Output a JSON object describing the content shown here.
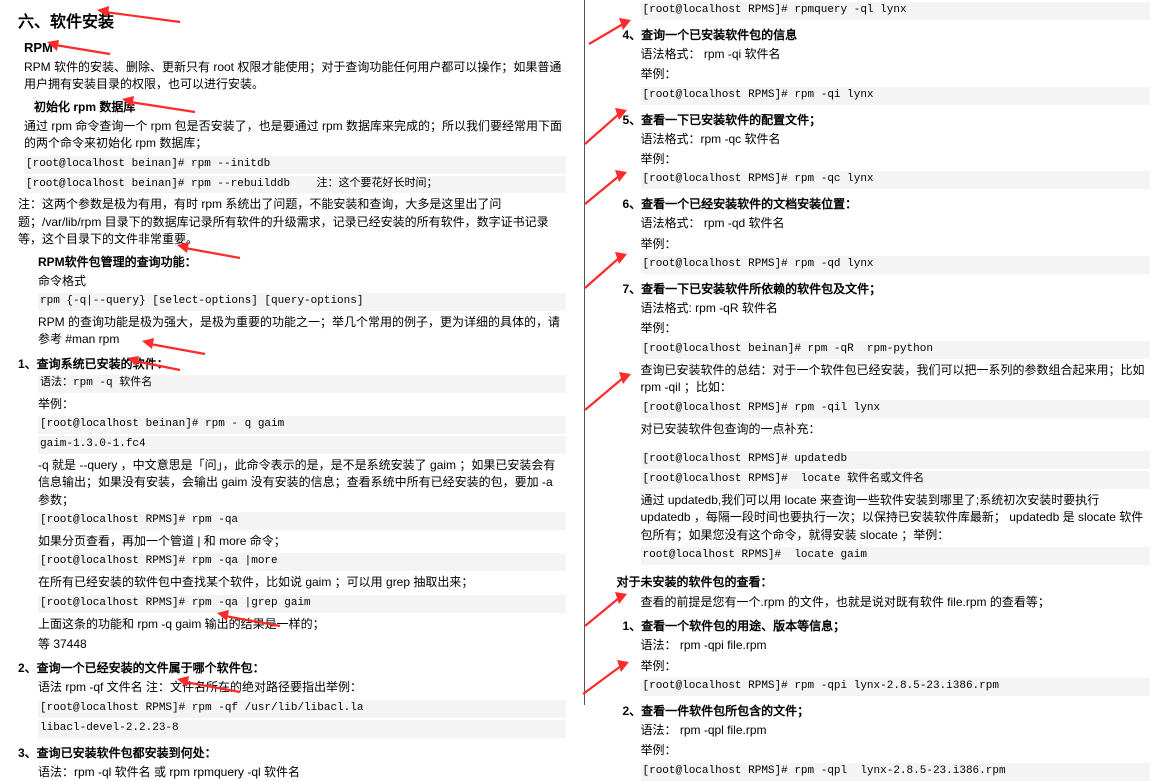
{
  "left": {
    "title": "六、软件安装",
    "rpm_hdr": "RPM",
    "para1": "RPM 软件的安装、删除、更新只有 root 权限才能使用；对于查询功能任何用户都可以操作；如果普通用户拥有安装目录的权限，也可以进行安装。",
    "init_hdr": "初始化 rpm 数据库",
    "init_p": "通过 rpm 命令查询一个 rpm 包是否安装了，也是要通过 rpm 数据库来完成的；所以我们要经常用下面的两个命令来初始化 rpm 数据库；",
    "init_c1": "[root@localhost beinan]# rpm --initdb",
    "init_c2": "[root@localhost beinan]# rpm --rebuilddb    注：这个要花好长时间；",
    "init_note": "注：这两个参数是极为有用，有时 rpm 系统出了问题，不能安装和查询，大多是这里出了问题；/var/lib/rpm 目录下的数据库记录所有软件的升级需求，记录已经安装的所有软件，数字证书记录等，这个目录下的文件非常重要。",
    "query_hdr": "RPM软件包管理的查询功能：",
    "query_fmt_lbl": "命令格式",
    "query_fmt": "rpm {-q|--query} [select-options] [query-options]",
    "query_note": "RPM 的查询功能是极为强大，是极为重要的功能之一；举几个常用的例子，更为详细的具体的，请参考 #man rpm",
    "i1_hdr": "1、查询系统已安装的软件：",
    "i1_syn": "语法：rpm -q 软件名",
    "i1_eg": "举例：",
    "i1_c1": "[root@localhost beinan]# rpm - q gaim",
    "i1_c2": "gaim-1.3.0-1.fc4",
    "i1_note": "-q 就是 --query ，中文意思是「问」，此命令表示的是，是不是系统安装了 gaim ；如果已安装会有信息输出；如果没有安装，会输出 gaim 没有安装的信息；查看系统中所有已经安装的包，要加 -a 参数；",
    "i1_c3": "[root@localhost RPMS]# rpm -qa",
    "i1_note2": "如果分页查看，再加一个管道 | 和 more 命令；",
    "i1_c4": "[root@localhost RPMS]# rpm -qa |more",
    "i1_note3": "在所有已经安装的软件包中查找某个软件，比如说 gaim ；可以用 grep 抽取出来；",
    "i1_c5": "[root@localhost RPMS]# rpm -qa |grep gaim",
    "i1_note4": "上面这条的功能和 rpm -q gaim 输出的结果是一样的；",
    "i1_note5": "等 37448",
    "i2_hdr": "2、查询一个已经安装的文件属于哪个软件包：",
    "i2_syn": "语法 rpm -qf 文件名   注：文件名所在的绝对路径要指出举例：",
    "i2_c1": "[root@localhost RPMS]# rpm -qf /usr/lib/libacl.la",
    "i2_c2": "libacl-devel-2.2.23-8",
    "i3_hdr": "3、查询已安装软件包都安装到何处：",
    "i3_syn": "语法：rpm -ql   软件名   或 rpm rpmquery -ql   软件名"
  },
  "right": {
    "pre_c": "[root@localhost RPMS]# rpmquery -ql lynx",
    "i4_hdr": "4、查询一个已安装软件包的信息",
    "i4_syn": "语法格式： rpm -qi 软件名",
    "i4_eg": "举例：",
    "i4_c1": "[root@localhost RPMS]# rpm -qi lynx",
    "i5_hdr": "5、查看一下已安装软件的配置文件；",
    "i5_syn": "语法格式：rpm -qc 软件名",
    "i5_eg": "举例：",
    "i5_c1": "[root@localhost RPMS]# rpm -qc lynx",
    "i6_hdr": "6、查看一个已经安装软件的文档安装位置：",
    "i6_syn": "语法格式： rpm -qd 软件名",
    "i6_eg": "举例：",
    "i6_c1": "[root@localhost RPMS]# rpm -qd lynx",
    "i7_hdr": "7、查看一下已安装软件所依赖的软件包及文件；",
    "i7_syn": "语法格式: rpm -qR 软件名",
    "i7_eg": "举例：",
    "i7_c1": "[root@localhost beinan]# rpm -qR  rpm-python",
    "i7_note": "查询已安装软件的总结：对于一个软件包已经安装，我们可以把一系列的参数组合起来用；比如 rpm -qil ；比如：",
    "i7_c2": "[root@localhost RPMS]# rpm -qil lynx",
    "i7_note2": "对已安装软件包查询的一点补充：",
    "i7_c3": "[root@localhost RPMS]# updatedb",
    "i7_c4": "[root@localhost RPMS]#  locate 软件名或文件名",
    "i7_note3": "通过 updatedb,我们可以用 locate 来查询一些软件安装到哪里了;系统初次安装时要执行 updatedb ，每隔一段时间也要执行一次；以保持已安装软件库最新； updatedb 是 slocate 软件包所有；如果您没有这个命令，就得安装 slocate ；举例：",
    "i7_c5": "root@localhost RPMS]#  locate gaim",
    "un_hdr": "对于未安装的软件包的查看：",
    "un_p": "查看的前提是您有一个.rpm 的文件，也就是说对既有软件 file.rpm 的查看等；",
    "u1_hdr": "1、查看一个软件包的用途、版本等信息；",
    "u1_syn": "语法： rpm -qpi file.rpm",
    "u1_eg": "举例：",
    "u1_c1": "[root@localhost RPMS]# rpm -qpi lynx-2.8.5-23.i386.rpm",
    "u2_hdr": "2、查看一件软件包所包含的文件；",
    "u2_syn": "语法： rpm -qpl   file.rpm",
    "u2_eg": "举例：",
    "u2_c1": "[root@localhost RPMS]# rpm -qpl  lynx-2.8.5-23.i386.rpm"
  }
}
